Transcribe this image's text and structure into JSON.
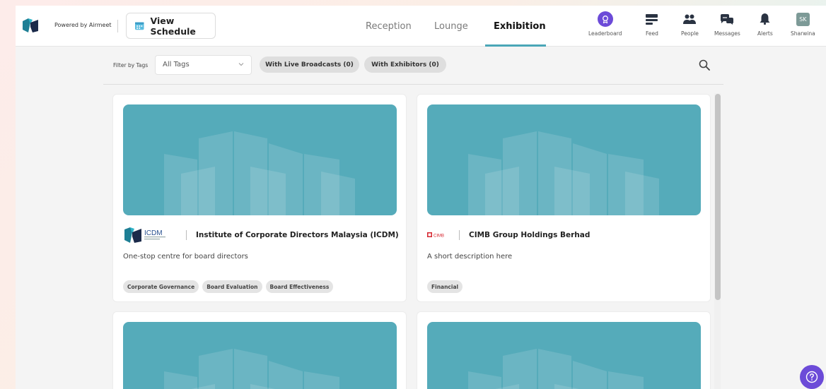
{
  "header": {
    "powered_by": "Powered by Airmeet",
    "view_schedule": "View Schedule",
    "tabs": [
      {
        "label": "Reception",
        "active": false
      },
      {
        "label": "Lounge",
        "active": false
      },
      {
        "label": "Exhibition",
        "active": true
      }
    ],
    "actions": [
      {
        "label": "Leaderboard",
        "icon": "trophy-icon"
      },
      {
        "label": "Feed",
        "icon": "feed-icon"
      },
      {
        "label": "People",
        "icon": "people-icon"
      },
      {
        "label": "Messages",
        "icon": "messages-icon"
      },
      {
        "label": "Alerts",
        "icon": "bell-icon"
      },
      {
        "label": "Sharwina",
        "icon": "avatar",
        "initials": "SK"
      }
    ]
  },
  "filters": {
    "label": "Filter by Tags",
    "select_value": "All Tags",
    "pills": [
      "With Live Broadcasts (0)",
      "With Exhibitors (0)"
    ]
  },
  "booths": [
    {
      "logo": "ICDM",
      "title": "Institute of Corporate Directors Malaysia (ICDM)",
      "description": "One-stop centre for board directors",
      "tags": [
        "Corporate Governance",
        "Board Evaluation",
        "Board Effectiveness"
      ]
    },
    {
      "logo": "CIMB",
      "title": "CIMB Group Holdings Berhad",
      "description": "A short description here",
      "tags": [
        "Financial"
      ]
    }
  ],
  "colors": {
    "accent": "#4aa6b7",
    "banner": "#55abba",
    "brand_purple": "#6c4bd8"
  }
}
